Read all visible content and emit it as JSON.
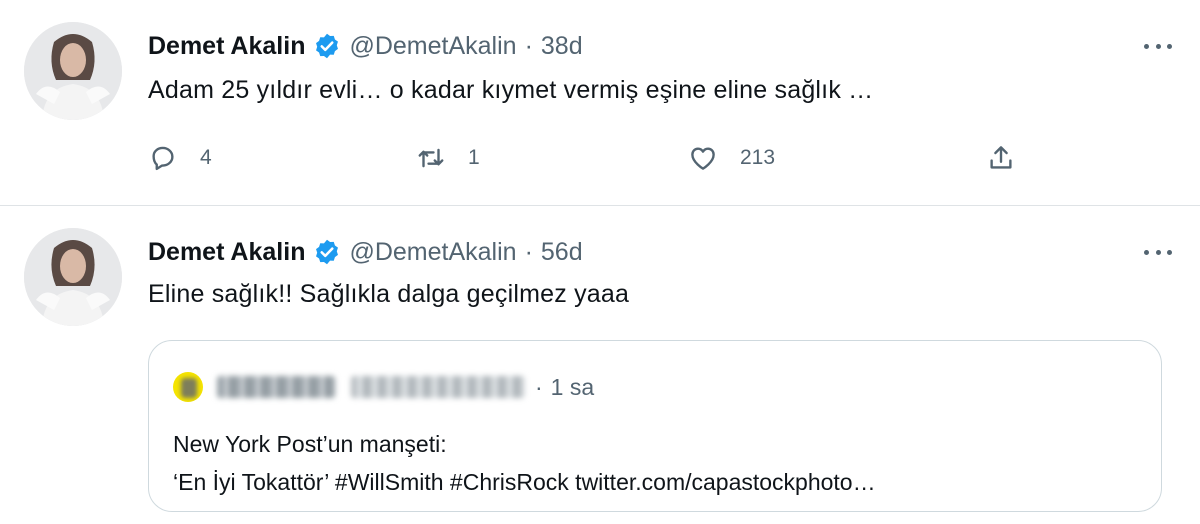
{
  "tweets": [
    {
      "author": {
        "name": "Demet Akalin",
        "handle": "@DemetAkalin",
        "verified": true
      },
      "time": "38d",
      "text": "Adam 25 yıldır evli… o kadar kıymet vermiş eşine eline sağlık …",
      "stats": {
        "replies": "4",
        "retweets": "1",
        "likes": "213"
      }
    },
    {
      "author": {
        "name": "Demet Akalin",
        "handle": "@DemetAkalin",
        "verified": true
      },
      "time": "56d",
      "text": "Eline sağlık!! Sağlıkla dalga geçilmez yaaa",
      "quote": {
        "time": "1 sa",
        "line1": "New York Post’un manşeti:",
        "line2": "‘En İyi Tokattör’ #WillSmith #ChrisRock twitter.com/capastockphoto…"
      }
    }
  ],
  "ui": {
    "separator": "·",
    "colors": {
      "text": "#0f1419",
      "secondary": "#536471",
      "verified": "#1d9bf0",
      "border": "#cfd9de"
    }
  }
}
